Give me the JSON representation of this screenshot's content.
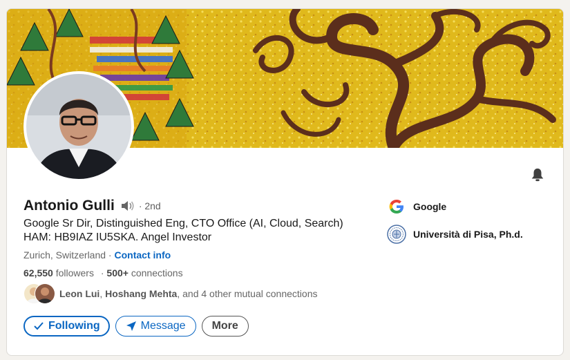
{
  "profile": {
    "name": "Antonio Gulli",
    "degree": "· 2nd",
    "headline_line1": "Google Sr Dir, Distinguished Eng, CTO Office (AI, Cloud, Search)",
    "headline_line2": "HAM: HB9IAZ IU5SKA. Angel Investor",
    "location": "Zurich, Switzerland",
    "separator": " · ",
    "contact_info": "Contact info",
    "followers_count": "62,550",
    "followers_label": " followers",
    "connections_count": "500+",
    "connections_label": " connections",
    "mutual_name1": "Leon Lui",
    "mutual_sep": ", ",
    "mutual_name2": "Hoshang Mehta",
    "mutual_rest": ", and 4 other mutual connections"
  },
  "actions": {
    "following": "Following",
    "message": "Message",
    "more": "More"
  },
  "experience": [
    {
      "label": "Google",
      "icon": "google-logo-icon"
    },
    {
      "label": "Università di Pisa, Ph.d.",
      "icon": "university-seal-icon"
    }
  ],
  "icons": {
    "speaker": "speaker-icon",
    "bell": "bell-icon",
    "check": "check-icon",
    "send": "send-icon"
  },
  "colors": {
    "link": "#0a66c2",
    "banner": "#e2bd1f",
    "tree_branch": "#5b2e1c"
  }
}
